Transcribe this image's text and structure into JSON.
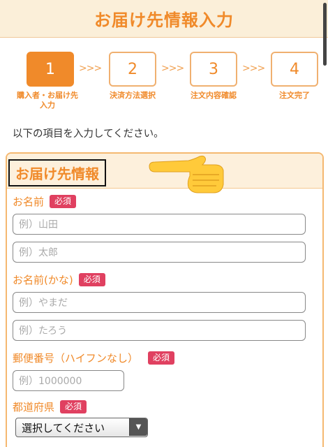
{
  "header": {
    "title": "お届け先情報入力"
  },
  "steps": [
    {
      "number": "1",
      "label": "購入者・お届け先入力",
      "active": true
    },
    {
      "number": "2",
      "label": "決済方法選択",
      "active": false
    },
    {
      "number": "3",
      "label": "注文内容確認",
      "active": false
    },
    {
      "number": "4",
      "label": "注文完了",
      "active": false
    }
  ],
  "step_arrow": ">>>",
  "intro": "以下の項目を入力してください。",
  "form": {
    "section_title": "お届け先情報",
    "required_badge": "必須",
    "name_label": "お名前",
    "last_name_placeholder": "例）山田",
    "first_name_placeholder": "例）太郎",
    "kana_label": "お名前(かな)",
    "last_kana_placeholder": "例）やまだ",
    "first_kana_placeholder": "例）たろう",
    "postal_label": "郵便番号（ハイフンなし）",
    "postal_placeholder": "例）1000000",
    "prefecture_label": "都道府県",
    "prefecture_value": "選択してください"
  },
  "colors": {
    "accent": "#f08a2a",
    "badge": "#e04060",
    "header_bg": "#fbefd9"
  }
}
